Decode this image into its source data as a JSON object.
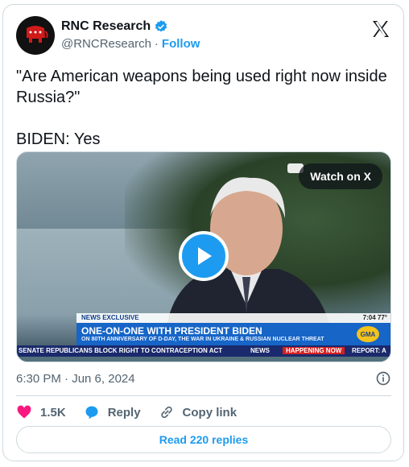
{
  "author": {
    "display_name": "RNC Research",
    "handle": "@RNCResearch",
    "separator": "·",
    "follow_label": "Follow",
    "verified_color": "#1d9bf0",
    "avatar_color": "#d11a1a"
  },
  "tweet": {
    "lines": [
      "\"Are American weapons being used right now inside Russia?\"",
      "BIDEN: Yes"
    ],
    "timestamp": "6:30 PM · Jun 6, 2024"
  },
  "media": {
    "watch_label": "Watch on X",
    "lower_third": {
      "exclusive": "NEWS EXCLUSIVE",
      "clock": "7:04 77°",
      "headline": "ONE-ON-ONE WITH PRESIDENT BIDEN",
      "subheadline": "ON 80TH ANNIVERSARY OF D-DAY, THE WAR IN UKRAINE & RUSSIAN NUCLEAR THREAT",
      "gma": "GMA",
      "ticker_1": "SENATE REPUBLICANS BLOCK RIGHT TO CONTRACEPTION ACT",
      "ticker_2": "NEWS",
      "ticker_3": "HAPPENING NOW",
      "ticker_4": "REPORT: A"
    }
  },
  "actions": {
    "likes": "1.5K",
    "reply_label": "Reply",
    "copy_label": "Copy link",
    "read_replies": "Read 220 replies",
    "like_color": "#f91880",
    "reply_color": "#1d9bf0"
  }
}
